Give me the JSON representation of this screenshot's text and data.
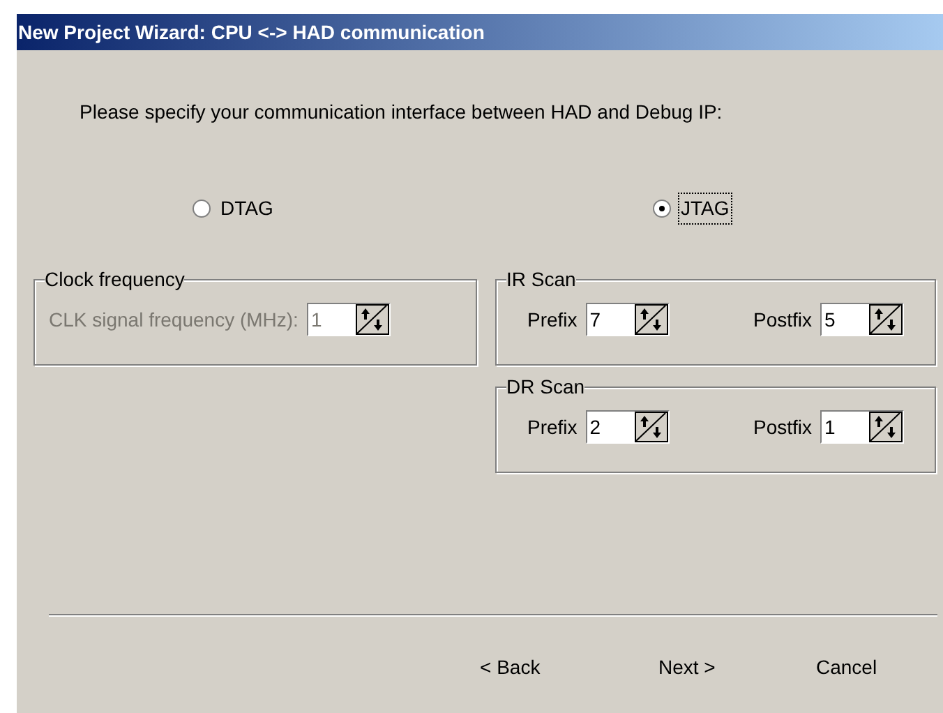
{
  "window": {
    "title": "New Project Wizard: CPU <-> HAD communication"
  },
  "prompt": "Please specify your communication interface between HAD and Debug IP:",
  "interfaces": [
    {
      "label": "DTAG",
      "selected": false,
      "focused": false
    },
    {
      "label": "JTAG",
      "selected": true,
      "focused": true
    }
  ],
  "clock_frequency": {
    "title": "Clock frequency",
    "label": "CLK signal frequency (MHz):",
    "value": "1",
    "disabled": true
  },
  "scan_groups": [
    {
      "title": "IR Scan",
      "fields": [
        {
          "label": "Prefix",
          "value": "7"
        },
        {
          "label": "Postfix",
          "value": "5"
        }
      ]
    },
    {
      "title": "DR Scan",
      "fields": [
        {
          "label": "Prefix",
          "value": "2"
        },
        {
          "label": "Postfix",
          "value": "1"
        }
      ]
    }
  ],
  "buttons": [
    "< Back",
    "Next >",
    "Cancel"
  ]
}
